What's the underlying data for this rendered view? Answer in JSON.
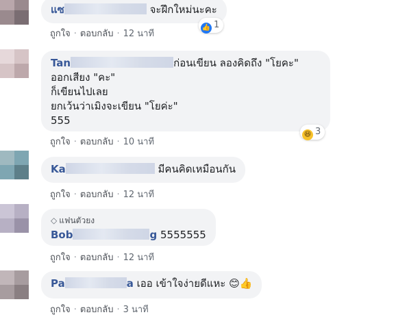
{
  "comments": [
    {
      "name_visible": "แซ",
      "text_lines": [
        "จะฝึกใหม่นะคะ"
      ],
      "actions": {
        "like": "ถูกใจ",
        "reply": "ตอบกลับ",
        "time": "12 นาที"
      },
      "reaction": {
        "icon": "like-icon",
        "count": "1"
      }
    },
    {
      "name_visible": "Tan",
      "text_lines": [
        "ก่อนเขียน ลองคิดถึง \"โยคะ\"",
        "ออกเสียง \"คะ\"",
        "ก็เขียนไปเลย",
        "ยกเว้นว่าเมิงจะเขียน \"โยค่ะ\"",
        "555"
      ],
      "actions": {
        "like": "ถูกใจ",
        "reply": "ตอบกลับ",
        "time": "10 นาที"
      },
      "reaction": {
        "icon": "haha-icon",
        "count": "3"
      }
    },
    {
      "name_visible": "Ka",
      "text_lines": [
        "มีคนคิดเหมือนกัน"
      ],
      "actions": {
        "like": "ถูกใจ",
        "reply": "ตอบกลับ",
        "time": "12 นาที"
      }
    },
    {
      "badge": "แฟนตัวยง",
      "name_visible": "Bob",
      "name_tail": "g",
      "text_lines": [
        "5555555"
      ],
      "actions": {
        "like": "ถูกใจ",
        "reply": "ตอบกลับ",
        "time": "12 นาที"
      }
    },
    {
      "name_visible": "Pa",
      "name_tail": "a",
      "text_lines": [
        "เออ เข้าใจง่ายดีแหะ"
      ],
      "emojis": [
        "😊",
        "👍"
      ],
      "actions": {
        "like": "ถูกใจ",
        "reply": "ตอบกลับ",
        "time": "3 นาที"
      }
    }
  ],
  "separator": "·",
  "colors": {
    "name": "#385898",
    "bubble": "#f2f3f5",
    "meta": "#606770",
    "like_blue": "#2078f4"
  }
}
